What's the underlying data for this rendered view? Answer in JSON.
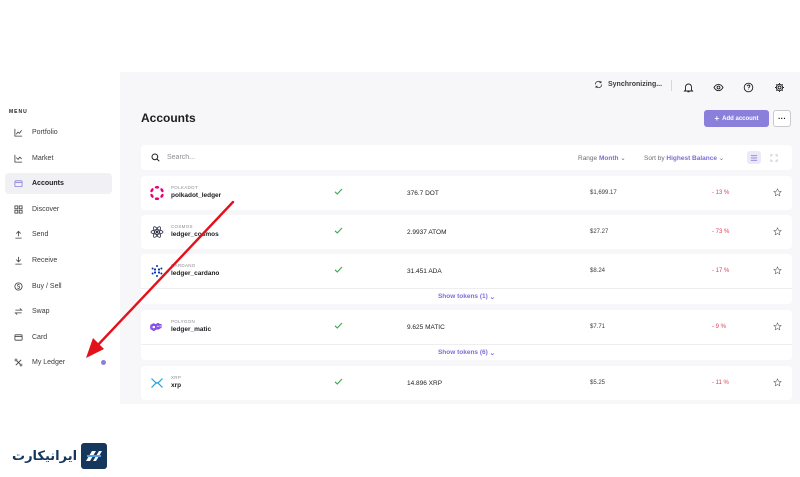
{
  "sidebar": {
    "menu_title": "MENU",
    "items": [
      {
        "label": "Portfolio",
        "icon": "chart-line-icon"
      },
      {
        "label": "Market",
        "icon": "trend-icon"
      },
      {
        "label": "Accounts",
        "icon": "wallet-icon",
        "active": true
      },
      {
        "label": "Discover",
        "icon": "grid-icon"
      },
      {
        "label": "Send",
        "icon": "arrow-up-icon"
      },
      {
        "label": "Receive",
        "icon": "arrow-down-icon"
      },
      {
        "label": "Buy / Sell",
        "icon": "dollar-circle-icon"
      },
      {
        "label": "Swap",
        "icon": "swap-icon"
      },
      {
        "label": "Card",
        "icon": "card-icon"
      },
      {
        "label": "My Ledger",
        "icon": "ledger-device-icon",
        "has_dot": true
      }
    ]
  },
  "topbar": {
    "sync_label": "Synchronizing...",
    "icons": [
      "bell-icon",
      "eye-icon",
      "help-icon",
      "settings-icon"
    ]
  },
  "page": {
    "title": "Accounts",
    "add_account": "Add account",
    "more": "···"
  },
  "search": {
    "placeholder": "Search...",
    "range_label": "Range",
    "range_value": "Month",
    "sort_label": "Sort by",
    "sort_value": "Highest Balance"
  },
  "accounts": [
    {
      "ticker": "POLKADOT",
      "name": "polkadot_ledger",
      "balance": "376.7 DOT",
      "fiat": "$1,699.17",
      "change": "- 13 %",
      "color": "#e6007a",
      "icon": "polkadot-icon"
    },
    {
      "ticker": "COSMOS",
      "name": "ledger_cosmos",
      "balance": "2.9937 ATOM",
      "fiat": "$27.27",
      "change": "- 73 %",
      "color": "#2e3148",
      "icon": "cosmos-icon"
    },
    {
      "ticker": "CARDANO",
      "name": "ledger_cardano",
      "balance": "31.451 ADA",
      "fiat": "$8.24",
      "change": "- 17 %",
      "color": "#0033ad",
      "icon": "cardano-icon",
      "tokens": "Show tokens (1)"
    },
    {
      "ticker": "POLYGON",
      "name": "ledger_matic",
      "balance": "9.625 MATIC",
      "fiat": "$7.71",
      "change": "- 9 %",
      "color": "#8247e5",
      "icon": "polygon-icon",
      "tokens": "Show tokens (6)"
    },
    {
      "ticker": "XRP",
      "name": "xrp",
      "balance": "14.896 XRP",
      "fiat": "$5.25",
      "change": "- 11 %",
      "color": "#23a3e0",
      "icon": "xrp-icon"
    }
  ],
  "colors": {
    "accent": "#8a80db",
    "negative": "#e0405a",
    "positive": "#3aa64e",
    "annotation_arrow": "#e3111a"
  },
  "watermark": {
    "text": "ایرانیکارت"
  }
}
